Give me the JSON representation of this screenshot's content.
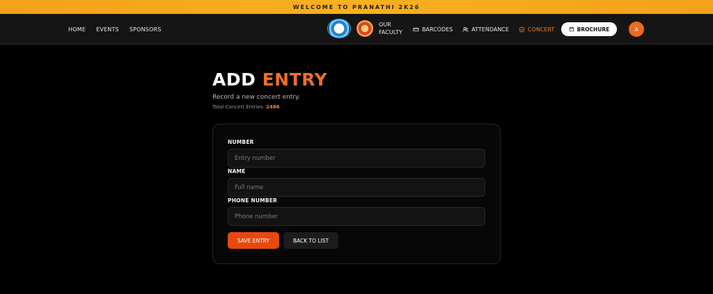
{
  "banner": {
    "text": "WELCOME TO PRANATHI 2K26"
  },
  "nav": {
    "left_links": [
      "HOME",
      "EVENTS",
      "SPONSORS"
    ],
    "faculty_line1": "OUR",
    "faculty_line2": "FACULTY",
    "barcodes": "BARCODES",
    "attendance": "ATTENDANCE",
    "concert": "CONCERT",
    "brochure": "BROCHURE",
    "avatar_initial": "A"
  },
  "page": {
    "title_main": "ADD",
    "title_accent": "ENTRY",
    "subtitle": "Record a new concert entry.",
    "total_label": "Total Concert Entries:",
    "total_count": "2486"
  },
  "form": {
    "number_label": "NUMBER",
    "number_placeholder": "Entry number",
    "name_label": "NAME",
    "name_placeholder": "Full name",
    "phone_label": "PHONE NUMBER",
    "phone_placeholder": "Phone number",
    "save_label": "SAVE ENTRY",
    "back_label": "BACK TO LIST"
  },
  "colors": {
    "accent": "#e8702e",
    "banner": "#f7b01f",
    "save_button": "#e8480e"
  }
}
